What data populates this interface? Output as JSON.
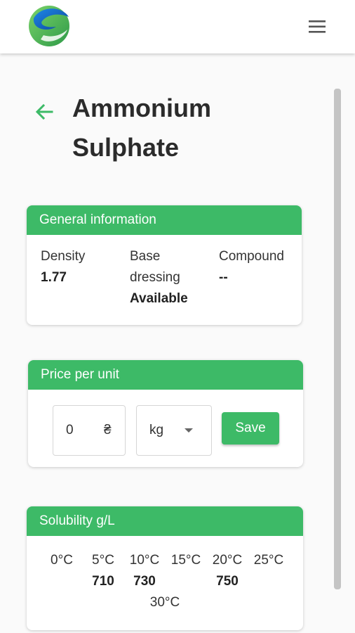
{
  "header": {
    "menu_icon": "hamburger-menu-icon",
    "logo_icon": "company-logo"
  },
  "page": {
    "title_line1": "Ammonium",
    "title_line2": "Sulphate",
    "back_icon": "arrow-left-icon"
  },
  "general_info": {
    "heading": "General information",
    "density_label": "Density",
    "density_value": "1.77",
    "base_label_line1": "Base",
    "base_label_line2": "dressing",
    "base_value": "Available",
    "compound_label": "Compound",
    "compound_value": "--"
  },
  "price": {
    "heading": "Price per unit",
    "value": "0",
    "currency": "₴",
    "unit": "kg",
    "save_label": "Save"
  },
  "solubility": {
    "heading": "Solubility g/L",
    "temps": [
      "0°C",
      "5°C",
      "10°C",
      "15°C",
      "20°C",
      "25°C",
      "30°C"
    ],
    "values": [
      "",
      "710",
      "730",
      "",
      "750",
      "",
      ""
    ]
  },
  "colors": {
    "accent": "#3dba67",
    "logo_blue": "#1565c0",
    "logo_green": "#4caf50"
  }
}
